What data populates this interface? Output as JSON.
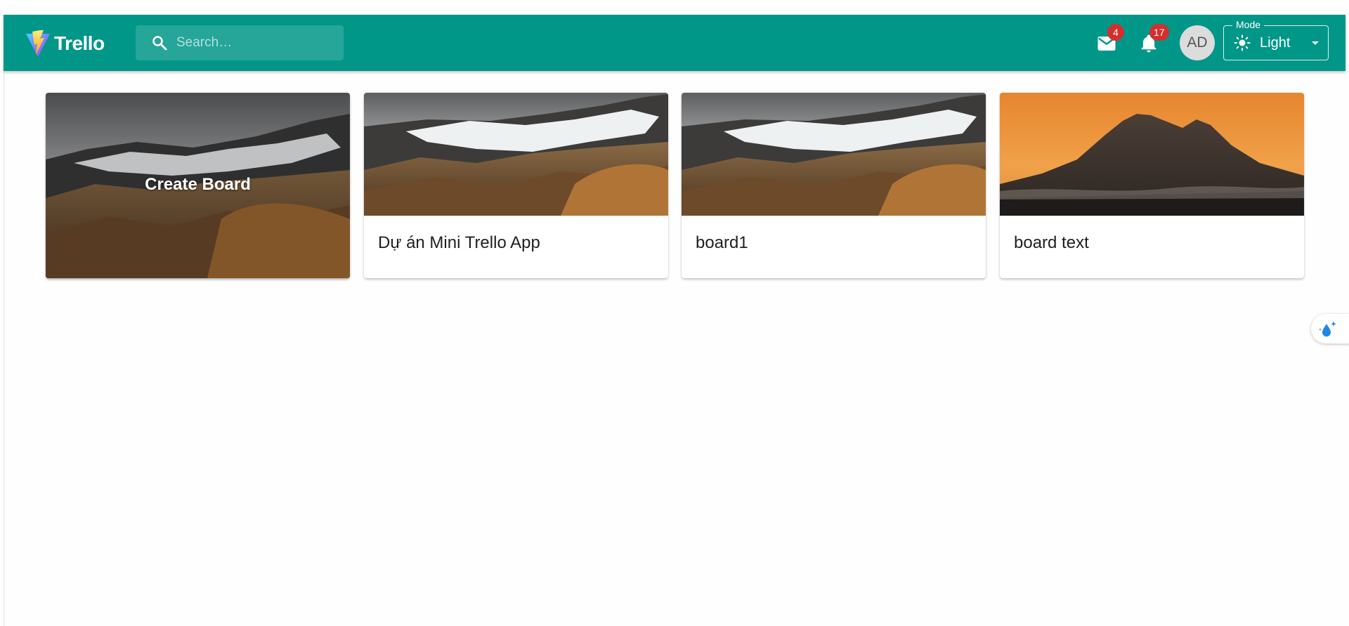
{
  "header": {
    "brand": "Trello",
    "search": {
      "placeholder": "Search…",
      "value": ""
    },
    "mail": {
      "icon": "mail-icon",
      "badge": "4"
    },
    "notifications": {
      "icon": "bell-icon",
      "badge": "17"
    },
    "avatar": {
      "initials": "AD"
    },
    "mode": {
      "label": "Mode",
      "value": "Light",
      "icon": "sun-icon"
    },
    "colors": {
      "appbar": "#009688",
      "badge": "#d32f2f"
    }
  },
  "boards": {
    "create_label": "Create Board",
    "items": [
      {
        "title": "Dự án Mini Trello App",
        "cover": "snowy-mountain"
      },
      {
        "title": "board1",
        "cover": "snowy-mountain"
      },
      {
        "title": "board text",
        "cover": "orange-sunset-mountain"
      }
    ]
  },
  "widget": {
    "icon": "water-drop-sparkle-icon"
  }
}
